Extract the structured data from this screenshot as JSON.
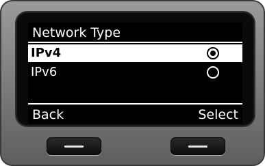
{
  "screen": {
    "title": "Network Type",
    "options": [
      {
        "label": "IPv4",
        "selected": true,
        "highlighted": true
      },
      {
        "label": "IPv6",
        "selected": false,
        "highlighted": false
      }
    ]
  },
  "softkeys": {
    "left": "Back",
    "right": "Select"
  },
  "colors": {
    "screen_bg": "#000000",
    "screen_fg": "#ffffff",
    "device_body": "#8a8a8a"
  }
}
